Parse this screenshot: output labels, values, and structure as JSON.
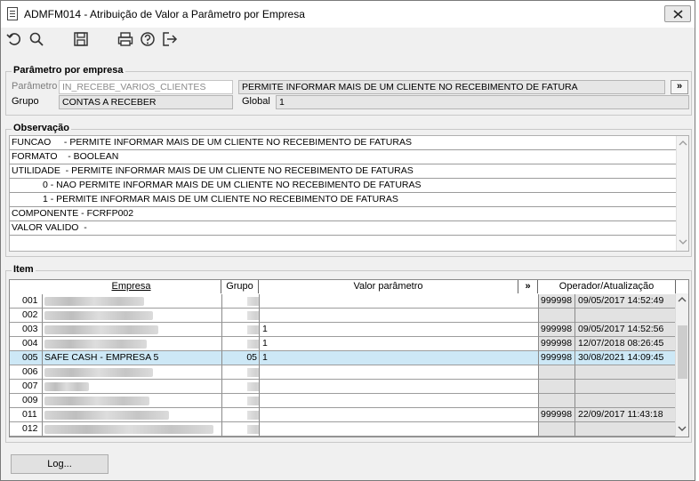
{
  "window": {
    "title": "ADMFM014 - Atribuição de Valor a Parâmetro por Empresa"
  },
  "toolbar": {
    "icons": [
      "undo-icon",
      "search-icon",
      "save-icon",
      "print-icon",
      "help-icon",
      "exit-icon"
    ]
  },
  "param_section": {
    "legend": "Parâmetro por empresa",
    "parametro_label": "Parâmetro",
    "parametro_value": "IN_RECEBE_VARIOS_CLIENTES",
    "parametro_desc": "PERMITE INFORMAR MAIS DE UM CLIENTE NO RECEBIMENTO DE FATURA",
    "more_label": "»",
    "grupo_label": "Grupo",
    "grupo_value": "CONTAS A RECEBER",
    "global_label": "Global",
    "global_value": "1"
  },
  "observacao": {
    "legend": "Observação",
    "lines": [
      "FUNCAO     - PERMITE INFORMAR MAIS DE UM CLIENTE NO RECEBIMENTO DE FATURAS",
      "FORMATO    - BOOLEAN",
      "UTILIDADE  - PERMITE INFORMAR MAIS DE UM CLIENTE NO RECEBIMENTO DE FATURAS",
      "            0 - NAO PERMITE INFORMAR MAIS DE UM CLIENTE NO RECEBIMENTO DE FATURAS",
      "            1 - PERMITE INFORMAR MAIS DE UM CLIENTE NO RECEBIMENTO DE FATURAS",
      "COMPONENTE - FCRFP002",
      "VALOR VALIDO  -"
    ]
  },
  "item_section": {
    "legend": "Item",
    "headers": {
      "empresa": "Empresa",
      "grupo": "Grupo",
      "valor": "Valor parâmetro",
      "more": "»",
      "operador": "Operador/Atualização"
    },
    "rows": [
      {
        "num": "001",
        "empresa": "",
        "grupo": "",
        "valor": "",
        "operador": "999998",
        "data": "09/05/2017 14:52:49"
      },
      {
        "num": "002",
        "empresa": "",
        "grupo": "",
        "valor": "",
        "operador": "",
        "data": ""
      },
      {
        "num": "003",
        "empresa": "",
        "grupo": "",
        "valor": "1",
        "operador": "999998",
        "data": "09/05/2017 14:52:56"
      },
      {
        "num": "004",
        "empresa": "",
        "grupo": "",
        "valor": "1",
        "operador": "999998",
        "data": "12/07/2018 08:26:45"
      },
      {
        "num": "005",
        "empresa": "SAFE CASH -  EMPRESA 5",
        "grupo": "05",
        "valor": "1",
        "operador": "999998",
        "data": "30/08/2021 14:09:45",
        "selected": true
      },
      {
        "num": "006",
        "empresa": "",
        "grupo": "",
        "valor": "",
        "operador": "",
        "data": ""
      },
      {
        "num": "007",
        "empresa": "",
        "grupo": "",
        "valor": "",
        "operador": "",
        "data": ""
      },
      {
        "num": "009",
        "empresa": "",
        "grupo": "",
        "valor": "",
        "operador": "",
        "data": ""
      },
      {
        "num": "011",
        "empresa": "",
        "grupo": "",
        "valor": "",
        "operador": "999998",
        "data": "22/09/2017 11:43:18"
      },
      {
        "num": "012",
        "empresa": "",
        "grupo": "",
        "valor": "",
        "operador": "",
        "data": ""
      }
    ]
  },
  "footer": {
    "log_button": "Log..."
  }
}
